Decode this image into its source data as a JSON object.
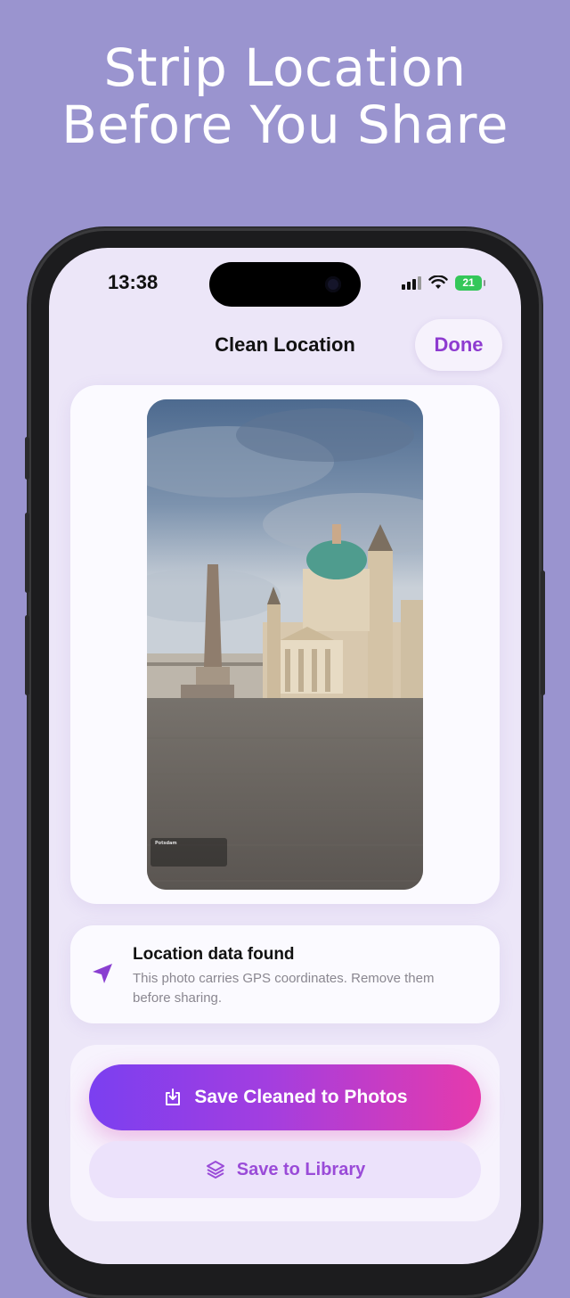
{
  "headline": {
    "line1": "Strip Location",
    "line2": "Before You Share"
  },
  "status_bar": {
    "time": "13:38",
    "battery": "21"
  },
  "nav": {
    "title": "Clean Location",
    "done_label": "Done"
  },
  "photo": {
    "overlay_city": "Potsdam"
  },
  "location_notice": {
    "icon": "location-arrow-icon",
    "title": "Location data found",
    "description": "This photo carries GPS coordinates. Remove them before sharing."
  },
  "actions": {
    "primary_label": "Save Cleaned to Photos",
    "primary_icon": "save-download-icon",
    "secondary_label": "Save to Library",
    "secondary_icon": "layers-stack-icon"
  },
  "colors": {
    "background": "#9a94cf",
    "accent": "#8e3bd0",
    "gradient_start": "#7b3ff0",
    "gradient_end": "#e63aac"
  }
}
